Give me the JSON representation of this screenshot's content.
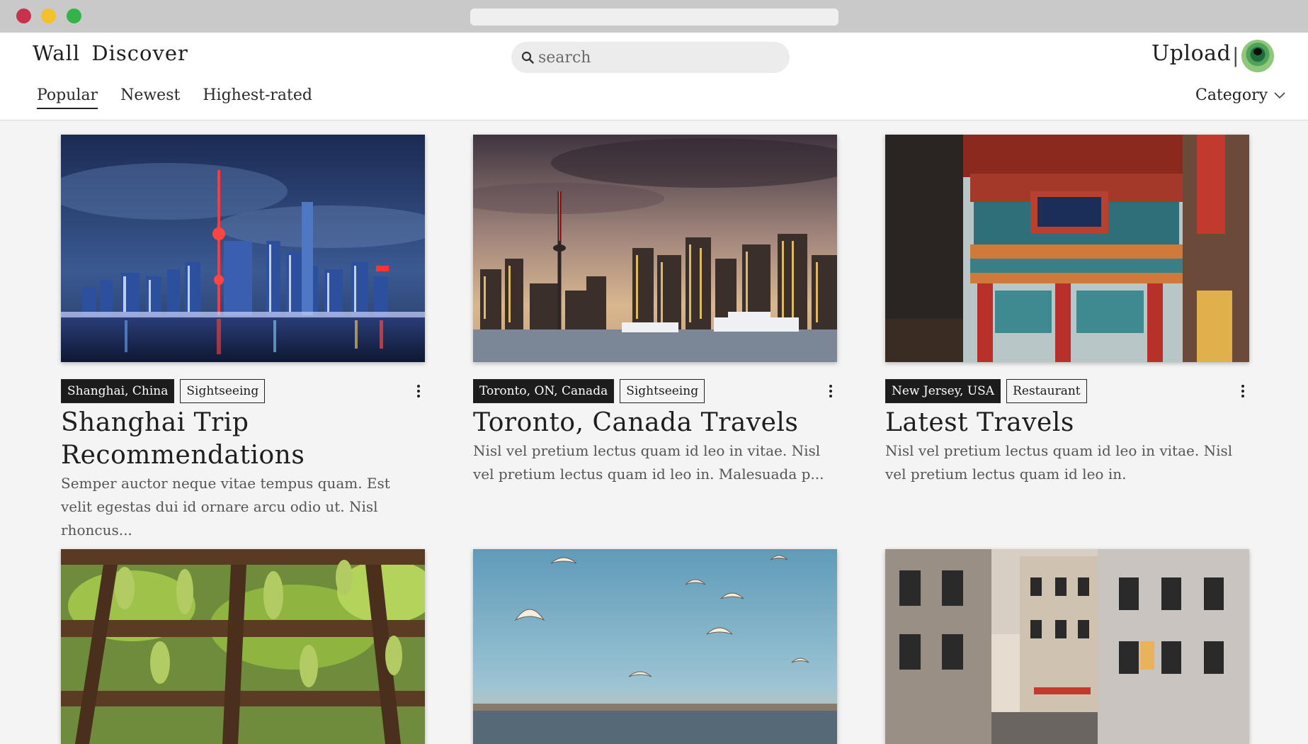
{
  "window": {
    "url": ""
  },
  "header": {
    "brand": "Wall  Discover",
    "search_placeholder": "search",
    "upload_label": "Upload",
    "separator": "|"
  },
  "tabs": [
    {
      "label": "Popular",
      "active": true
    },
    {
      "label": "Newest",
      "active": false
    },
    {
      "label": "Highest-rated",
      "active": false
    }
  ],
  "category_label": "Category",
  "cards": [
    {
      "location": "Shanghai, China",
      "tag": "Sightseeing",
      "title": "Shanghai Trip Recommendations",
      "description": "Semper auctor neque vitae tempus quam. Est velit egestas dui id ornare arcu odio ut. Nisl rhoncus...",
      "image": "shanghai-night-skyline"
    },
    {
      "location": "Toronto, ON, Canada",
      "tag": "Sightseeing",
      "title": "Toronto, Canada Travels",
      "description": "Nisl vel pretium lectus quam id leo in vitae. Nisl vel pretium lectus quam id leo in. Malesuada p...",
      "image": "toronto-skyline-dusk"
    },
    {
      "location": "New Jersey, USA",
      "tag": "Restaurant",
      "title": "Latest Travels",
      "description": "Nisl vel pretium lectus quam id leo in vitae. Nisl vel pretium lectus quam id leo in.",
      "image": "chinatown-gate"
    },
    {
      "image": "grape-vine-pergola"
    },
    {
      "image": "seagulls-over-river"
    },
    {
      "image": "paris-street"
    }
  ],
  "colors": {
    "accent": "#1c1c1c",
    "background": "#f4f4f4",
    "chrome": "#c9c9c9"
  }
}
